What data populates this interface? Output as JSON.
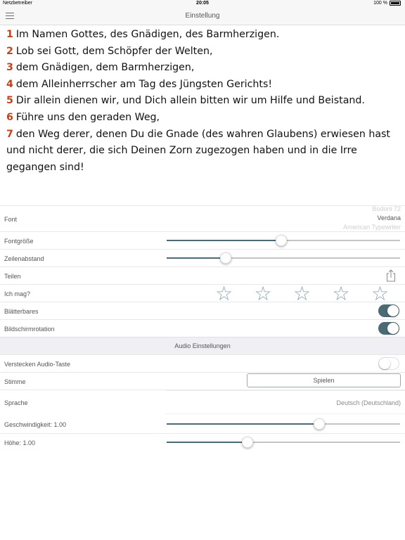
{
  "status_bar": {
    "carrier": "Netzbetreiber",
    "time": "20:05",
    "battery": "100 %"
  },
  "nav": {
    "title": "Einstellung"
  },
  "verses": [
    {
      "num": "1",
      "text": "Im Namen Gottes, des Gnädigen, des Barmherzigen."
    },
    {
      "num": "2",
      "text": "Lob sei Gott, dem Schöpfer der Welten,"
    },
    {
      "num": "3",
      "text": "dem Gnädigen, dem Barmherzigen,"
    },
    {
      "num": "4",
      "text": "dem Alleinherrscher am Tag des Jüngsten Gerichts!"
    },
    {
      "num": "5",
      "text": "Dir allein dienen wir, und Dich allein bitten wir um Hilfe und Beistand."
    },
    {
      "num": "6",
      "text": "Führe uns den geraden Weg,"
    },
    {
      "num": "7",
      "text": "den Weg derer, denen Du die Gnade (des wahren Glaubens) erwiesen hast und nicht derer, die sich Deinen Zorn zugezogen haben und in die Irre gegangen sind!"
    }
  ],
  "settings": {
    "font_label": "Font",
    "font_options": [
      "Bodoni 72",
      "Verdana",
      "American Typewriter"
    ],
    "font_size_label": "Fontgröße",
    "font_size_value": 0.49,
    "line_spacing_label": "Zeilenabstand",
    "line_spacing_value": 0.24,
    "share_label": "Teilen",
    "like_label": "Ich mag?",
    "rating": 0,
    "rating_max": 5,
    "paging_label": "Blätterbares",
    "paging_on": true,
    "rotation_label": "Bildschirmrotation",
    "rotation_on": true
  },
  "audio": {
    "section_title": "Audio Einstellungen",
    "hide_button_label": "Verstecken Audio-Taste",
    "hide_button_on": false,
    "voice_label": "Stimme",
    "play_label": "Spielen",
    "language_label": "Sprache",
    "language_value": "Deutsch (Deutschland)",
    "speed_label": "Geschwindigkeit: 1.00",
    "speed_value": 0.66,
    "pitch_label": "Höhe: 1.00",
    "pitch_value": 0.34
  },
  "colors": {
    "accent": "#4a6a74",
    "verse_number": "#c1421c",
    "star": "#8fa3ab"
  },
  "icons": {
    "menu": "hamburger-icon",
    "share": "share-icon",
    "star": "star-outline-icon",
    "battery": "battery-icon",
    "wifi": "wifi-icon"
  }
}
